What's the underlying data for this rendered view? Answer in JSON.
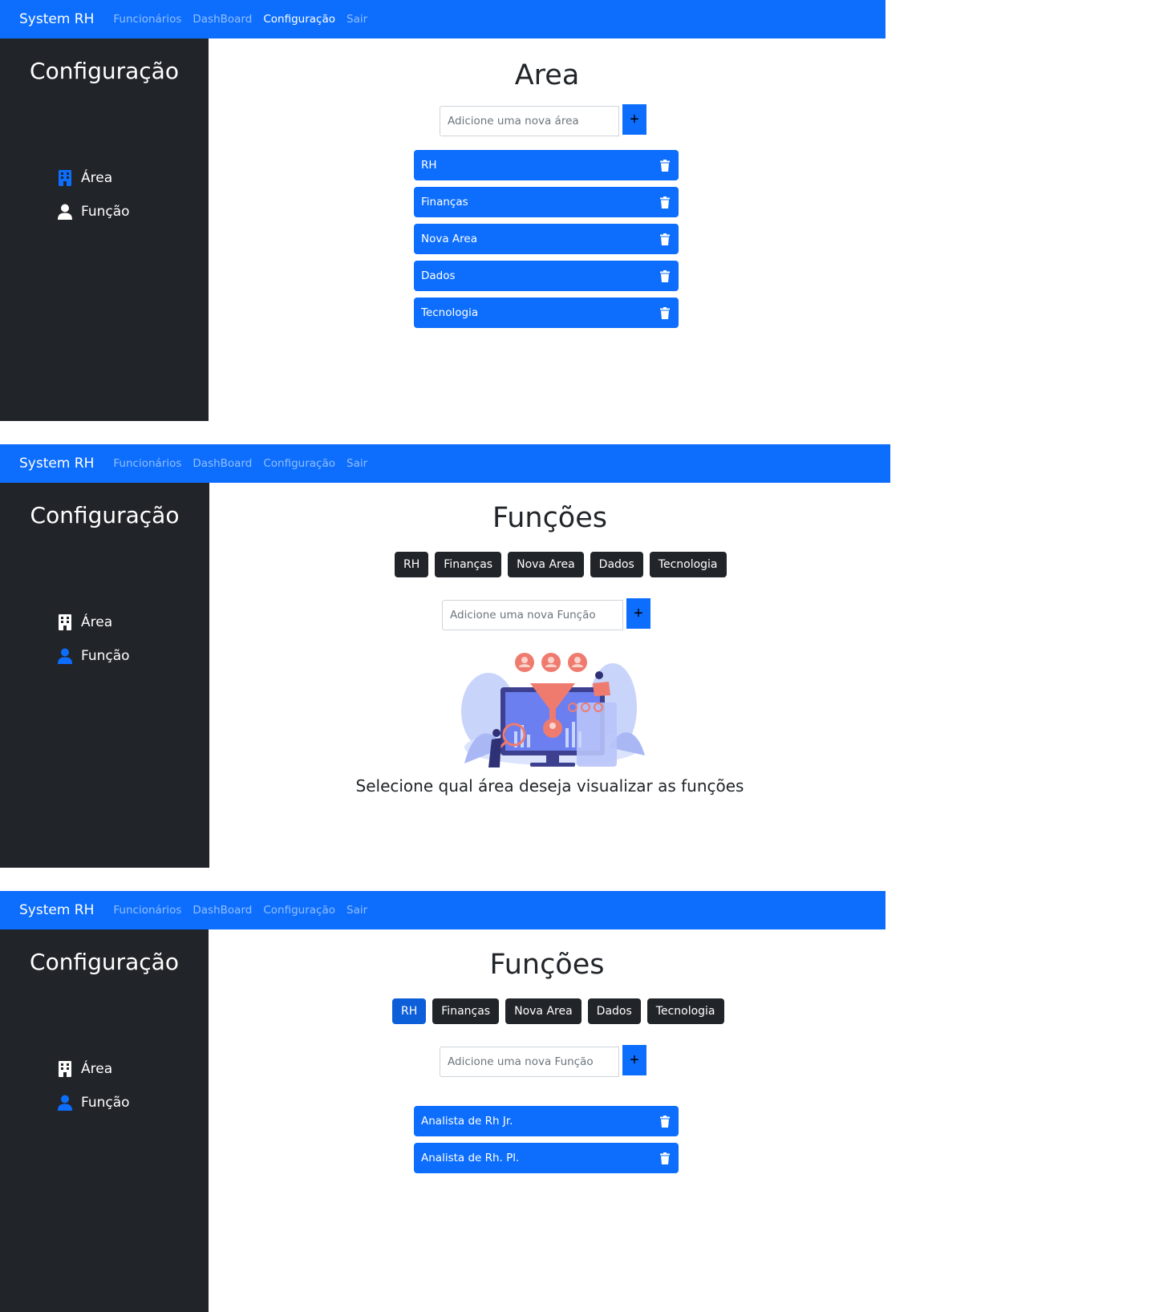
{
  "navbar": {
    "brand": "System RH",
    "links": [
      "Funcionários",
      "DashBoard",
      "Configuração",
      "Sair"
    ]
  },
  "sidebar": {
    "title": "Configuração",
    "items": [
      {
        "label": "Área",
        "icon": "building-icon"
      },
      {
        "label": "Função",
        "icon": "person-icon"
      }
    ]
  },
  "area_page": {
    "title": "Area",
    "input_placeholder": "Adicione uma nova área",
    "add_label": "+",
    "items": [
      "RH",
      "Finanças",
      "Nova Area",
      "Dados",
      "Tecnologia"
    ]
  },
  "funcoes_page": {
    "title": "Funções",
    "filters": [
      "RH",
      "Finanças",
      "Nova Area",
      "Dados",
      "Tecnologia"
    ],
    "input_placeholder": "Adicione uma nova Função",
    "add_label": "+",
    "empty_message": "Selecione qual área deseja visualizar as funções"
  },
  "funcoes_selected": {
    "title": "Funções",
    "selected_filter": "RH",
    "items": [
      "Analista de Rh Jr.",
      "Analista de Rh. Pl."
    ]
  },
  "colors": {
    "primary": "#0d6efd",
    "sidebar": "#212529",
    "dark_button": "#212529",
    "active_button": "#0d5fd9"
  }
}
